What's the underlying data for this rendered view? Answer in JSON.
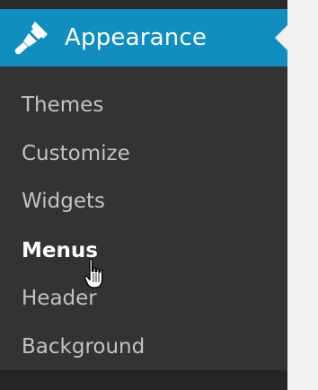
{
  "menu": {
    "section_label": "Appearance",
    "section_icon": "paintbrush-icon",
    "submenu": [
      {
        "label": "Themes",
        "current": false
      },
      {
        "label": "Customize",
        "current": false
      },
      {
        "label": "Widgets",
        "current": false
      },
      {
        "label": "Menus",
        "current": true
      },
      {
        "label": "Header",
        "current": false
      },
      {
        "label": "Background",
        "current": false
      }
    ]
  },
  "cursor": {
    "icon": "hand-pointer-icon"
  },
  "colors": {
    "header_background": "#0f8ebf",
    "submenu_background": "#333333",
    "submenu_text": "#c3c3c3",
    "active_text": "#ffffff",
    "page_background": "#f1f1f1"
  }
}
